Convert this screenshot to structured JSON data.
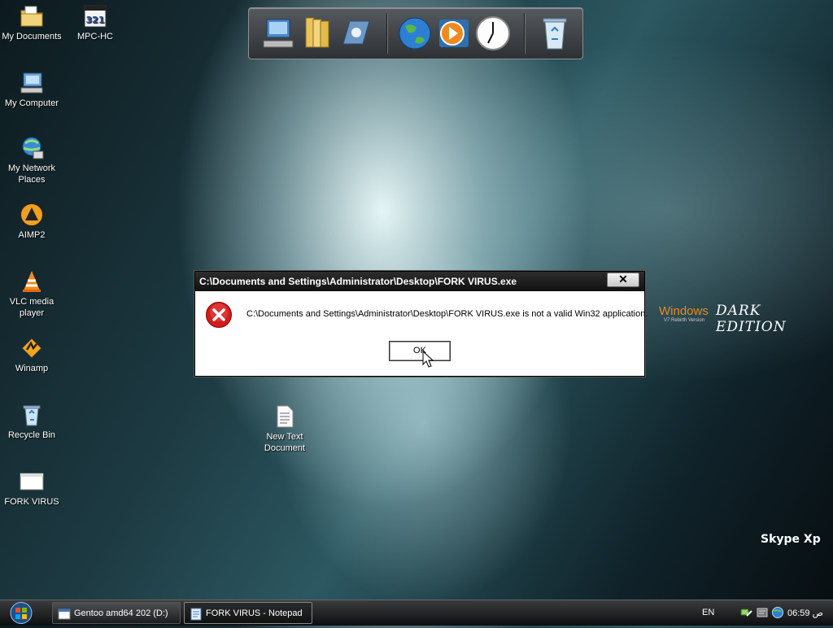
{
  "desktop": {
    "icons": [
      {
        "label": "My Documents",
        "icon": "folder-documents-icon"
      },
      {
        "label": "MPC-HC",
        "icon": "mpc-hc-icon"
      },
      {
        "label": "My Computer",
        "icon": "computer-icon"
      },
      {
        "label": "My Network Places",
        "icon": "network-icon"
      },
      {
        "label": "AIMP2",
        "icon": "aimp-icon"
      },
      {
        "label": "VLC media player",
        "icon": "vlc-icon"
      },
      {
        "label": "Winamp",
        "icon": "winamp-icon"
      },
      {
        "label": "Recycle Bin",
        "icon": "recycle-bin-icon"
      },
      {
        "label": "FORK VIRUS",
        "icon": "window-app-icon"
      },
      {
        "label": "New Text Document",
        "icon": "text-document-icon"
      }
    ],
    "branding": {
      "windows_word": "Windows",
      "edition": "DARK EDITION",
      "version": "V7 Rebirth Version",
      "skype": "Skype Xp"
    }
  },
  "dock": {
    "items": [
      "computer-icon",
      "folders-icon",
      "control-panel-icon",
      "globe-icon",
      "media-player-icon",
      "clock-icon",
      "recycle-bin-icon"
    ]
  },
  "dialog": {
    "title": "C:\\Documents and Settings\\Administrator\\Desktop\\FORK VIRUS.exe",
    "message": "C:\\Documents and Settings\\Administrator\\Desktop\\FORK VIRUS.exe is not a valid Win32 application.",
    "ok_label": "OK",
    "close_glyph": "✕",
    "icon": "error-icon"
  },
  "taskbar": {
    "tasks": [
      {
        "label": "Gentoo amd64 202 (D:)",
        "active": false
      },
      {
        "label": "FORK VIRUS - Notepad",
        "active": true
      }
    ],
    "language": "EN",
    "clock": "06:59 ص"
  }
}
